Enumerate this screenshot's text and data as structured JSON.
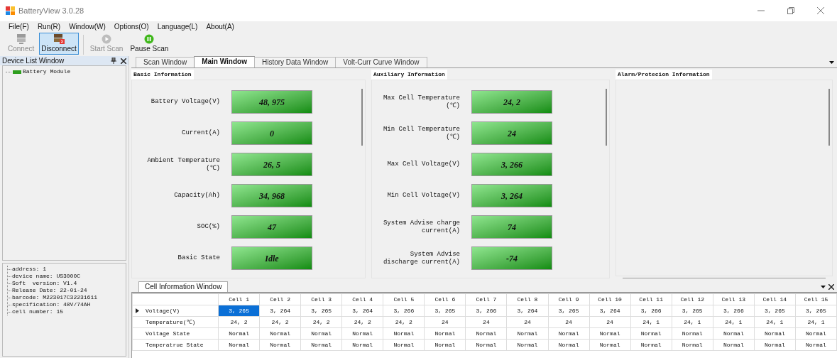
{
  "window": {
    "title": "BatteryView 3.0.28"
  },
  "menu": [
    "File(F)",
    "Run(R)",
    "Window(W)",
    "Options(O)",
    "Language(L)",
    "About(A)"
  ],
  "toolbar": [
    {
      "label": "Connect",
      "kind": "connect",
      "disabled": true,
      "selected": false
    },
    {
      "label": "Disconnect",
      "kind": "disconnect",
      "disabled": false,
      "selected": true
    },
    {
      "label": "Start Scan",
      "kind": "start",
      "disabled": true,
      "selected": false
    },
    {
      "label": "Pause Scan",
      "kind": "pause",
      "disabled": false,
      "selected": false
    }
  ],
  "device_list": {
    "title": "Device List Window",
    "items": [
      "Battery Module"
    ]
  },
  "device_properties": [
    "address: 1",
    "device name: US3000C",
    "Soft  version: V1.4",
    "Release Date: 22-01-24",
    "barcode: M223017C32231611",
    "specification: 48V/74AH",
    "cell number: 15"
  ],
  "tabs": [
    {
      "label": "Scan Window",
      "selected": false
    },
    {
      "label": "Main Window",
      "selected": true
    },
    {
      "label": "History Data Window",
      "selected": false
    },
    {
      "label": "Volt-Curr Curve Window",
      "selected": false
    }
  ],
  "panels": [
    {
      "title": "Basic Information",
      "rows": [
        {
          "label": "Battery Voltage(V)",
          "value": "48, 975"
        },
        {
          "label": "Current(A)",
          "value": "0"
        },
        {
          "label": "Ambient Temperature\n(℃)",
          "value": "26, 5"
        },
        {
          "label": "Capacity(Ah)",
          "value": "34, 968"
        },
        {
          "label": "SOC(%)",
          "value": "47"
        },
        {
          "label": "Basic State",
          "value": "Idle"
        }
      ]
    },
    {
      "title": "Auxiliary Information",
      "rows": [
        {
          "label": "Max Cell Temperature\n(℃)",
          "value": "24, 2"
        },
        {
          "label": "Min Cell Temperature\n(℃)",
          "value": "24"
        },
        {
          "label": "Max Cell Voltage(V)",
          "value": "3, 266"
        },
        {
          "label": "Min Cell Voltage(V)",
          "value": "3, 264"
        },
        {
          "label": "System Advise charge\ncurrent(A)",
          "value": "74"
        },
        {
          "label": "System Advise\ndischarge current(A)",
          "value": "-74"
        }
      ]
    },
    {
      "title": "Alarm/Protecion Information"
    }
  ],
  "cell_window": {
    "title": "Cell Information Window",
    "columns": [
      "Cell 1",
      "Cell 2",
      "Cell 3",
      "Cell 4",
      "Cell 5",
      "Cell 6",
      "Cell 7",
      "Cell 8",
      "Cell 9",
      "Cell 10",
      "Cell 11",
      "Cell 12",
      "Cell 13",
      "Cell 14",
      "Cell 15"
    ],
    "rows": [
      {
        "label": "Voltage(V)",
        "current": true,
        "cells": [
          {
            "text": "3, 265",
            "selected": true
          },
          {
            "text": "3, 264",
            "selected": false
          },
          {
            "text": "3, 265",
            "selected": false
          },
          {
            "text": "3, 264",
            "selected": false
          },
          {
            "text": "3, 266",
            "selected": false
          },
          {
            "text": "3, 265",
            "selected": false
          },
          {
            "text": "3, 266",
            "selected": false
          },
          {
            "text": "3, 264",
            "selected": false
          },
          {
            "text": "3, 265",
            "selected": false
          },
          {
            "text": "3, 264",
            "selected": false
          },
          {
            "text": "3, 266",
            "selected": false
          },
          {
            "text": "3, 265",
            "selected": false
          },
          {
            "text": "3, 266",
            "selected": false
          },
          {
            "text": "3, 265",
            "selected": false
          },
          {
            "text": "3, 265",
            "selected": false
          }
        ]
      },
      {
        "label": "Temperature(℃)",
        "current": false,
        "cells": [
          {
            "text": "24, 2",
            "selected": false
          },
          {
            "text": "24, 2",
            "selected": false
          },
          {
            "text": "24, 2",
            "selected": false
          },
          {
            "text": "24, 2",
            "selected": false
          },
          {
            "text": "24, 2",
            "selected": false
          },
          {
            "text": "24",
            "selected": false
          },
          {
            "text": "24",
            "selected": false
          },
          {
            "text": "24",
            "selected": false
          },
          {
            "text": "24",
            "selected": false
          },
          {
            "text": "24",
            "selected": false
          },
          {
            "text": "24, 1",
            "selected": false
          },
          {
            "text": "24, 1",
            "selected": false
          },
          {
            "text": "24, 1",
            "selected": false
          },
          {
            "text": "24, 1",
            "selected": false
          },
          {
            "text": "24, 1",
            "selected": false
          }
        ]
      },
      {
        "label": "Voltage State",
        "current": false,
        "cells": [
          {
            "text": "Normal",
            "selected": false
          },
          {
            "text": "Normal",
            "selected": false
          },
          {
            "text": "Normal",
            "selected": false
          },
          {
            "text": "Normal",
            "selected": false
          },
          {
            "text": "Normal",
            "selected": false
          },
          {
            "text": "Normal",
            "selected": false
          },
          {
            "text": "Normal",
            "selected": false
          },
          {
            "text": "Normal",
            "selected": false
          },
          {
            "text": "Normal",
            "selected": false
          },
          {
            "text": "Normal",
            "selected": false
          },
          {
            "text": "Normal",
            "selected": false
          },
          {
            "text": "Normal",
            "selected": false
          },
          {
            "text": "Normal",
            "selected": false
          },
          {
            "text": "Normal",
            "selected": false
          },
          {
            "text": "Normal",
            "selected": false
          }
        ]
      },
      {
        "label": "Temperatrue State",
        "current": false,
        "cells": [
          {
            "text": "Normal",
            "selected": false
          },
          {
            "text": "Normal",
            "selected": false
          },
          {
            "text": "Normal",
            "selected": false
          },
          {
            "text": "Normal",
            "selected": false
          },
          {
            "text": "Normal",
            "selected": false
          },
          {
            "text": "Normal",
            "selected": false
          },
          {
            "text": "Normal",
            "selected": false
          },
          {
            "text": "Normal",
            "selected": false
          },
          {
            "text": "Normal",
            "selected": false
          },
          {
            "text": "Normal",
            "selected": false
          },
          {
            "text": "Normal",
            "selected": false
          },
          {
            "text": "Normal",
            "selected": false
          },
          {
            "text": "Normal",
            "selected": false
          },
          {
            "text": "Normal",
            "selected": false
          },
          {
            "text": "Normal",
            "selected": false
          }
        ]
      }
    ]
  }
}
